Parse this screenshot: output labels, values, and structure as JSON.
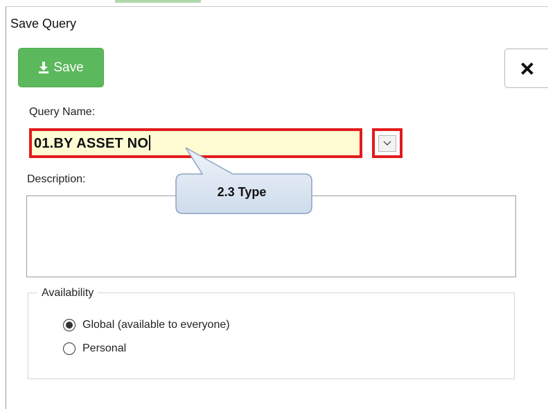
{
  "dialog": {
    "title": "Save Query",
    "save_label": "Save",
    "query_name_label": "Query Name:",
    "query_name_value": "01.BY ASSET NO",
    "description_label": "Description:",
    "description_value": "",
    "availability_legend": "Availability",
    "options": [
      {
        "label": "Global (available to everyone)",
        "selected": true
      },
      {
        "label": "Personal",
        "selected": false
      }
    ]
  },
  "callout": {
    "text": "2.3 Type"
  },
  "colors": {
    "save_button": "#5cb85c",
    "highlight_border": "#e21b1b",
    "input_fill": "#fffbd3",
    "callout_fill": "#dbe5f1",
    "callout_border": "#8aa2c4"
  },
  "icons": {
    "save": "download-icon",
    "close": "close-icon",
    "dropdown": "chevron-down-icon"
  }
}
